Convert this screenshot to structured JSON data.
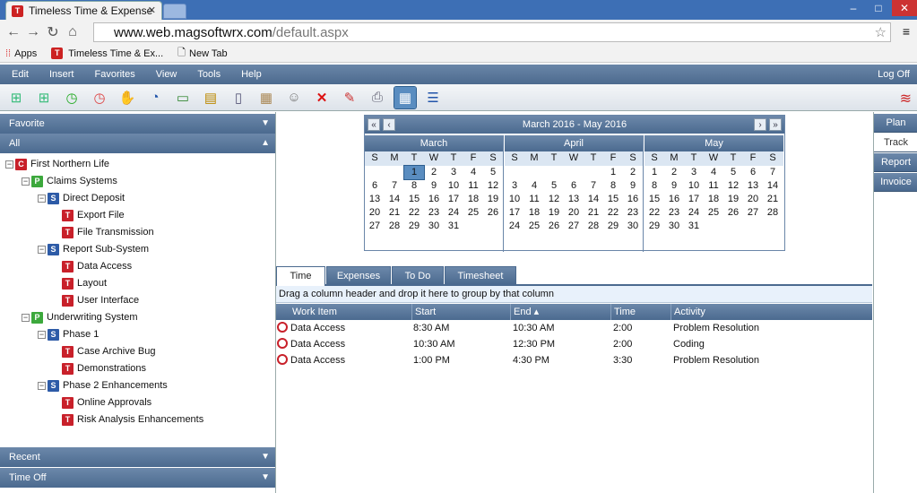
{
  "browser": {
    "tab_title": "Timeless Time & Expense",
    "url_domain": "www.web.magsoftwrx.com",
    "url_path": "/default.aspx"
  },
  "bookmarks": {
    "apps": "Apps",
    "site": "Timeless Time & Ex...",
    "newtab": "New Tab"
  },
  "menu": {
    "items": [
      "Edit",
      "Insert",
      "Favorites",
      "View",
      "Tools",
      "Help"
    ],
    "logoff": "Log Off"
  },
  "toolbar": {
    "icons": [
      "add-folder-icon",
      "add-item-icon",
      "start-timer-icon",
      "stop-timer-icon",
      "hand-icon",
      "stopwatch-icon",
      "money-icon",
      "clipboard-icon",
      "document-icon",
      "table-icon",
      "user-icon",
      "delete-icon",
      "edit-icon",
      "print-icon",
      "calendar-icon",
      "tree-icon"
    ]
  },
  "sidebar": {
    "favorite": "Favorite",
    "all": "All",
    "recent": "Recent",
    "timeoff": "Time Off"
  },
  "tree": [
    {
      "badge": "C",
      "label": "First Northern Life",
      "level": 0,
      "expander": "−"
    },
    {
      "badge": "P",
      "label": "Claims Systems",
      "level": 1,
      "expander": "−"
    },
    {
      "badge": "S",
      "label": "Direct Deposit",
      "level": 2,
      "expander": "−"
    },
    {
      "badge": "T",
      "label": "Export File",
      "level": 3,
      "expander": ""
    },
    {
      "badge": "T",
      "label": "File Transmission",
      "level": 3,
      "expander": ""
    },
    {
      "badge": "S",
      "label": "Report Sub-System",
      "level": 2,
      "expander": "−"
    },
    {
      "badge": "T",
      "label": "Data Access",
      "level": 3,
      "expander": ""
    },
    {
      "badge": "T",
      "label": "Layout",
      "level": 3,
      "expander": ""
    },
    {
      "badge": "T",
      "label": "User Interface",
      "level": 3,
      "expander": ""
    },
    {
      "badge": "P",
      "label": "Underwriting System",
      "level": 1,
      "expander": "−"
    },
    {
      "badge": "S",
      "label": "Phase 1",
      "level": 2,
      "expander": "−"
    },
    {
      "badge": "T",
      "label": "Case Archive Bug",
      "level": 3,
      "expander": ""
    },
    {
      "badge": "T",
      "label": "Demonstrations",
      "level": 3,
      "expander": ""
    },
    {
      "badge": "S",
      "label": "Phase 2 Enhancements",
      "level": 2,
      "expander": "−"
    },
    {
      "badge": "T",
      "label": "Online Approvals",
      "level": 3,
      "expander": ""
    },
    {
      "badge": "T",
      "label": "Risk Analysis Enhancements",
      "level": 3,
      "expander": ""
    }
  ],
  "calendar": {
    "range": "March 2016 - May 2016",
    "dow": [
      "S",
      "M",
      "T",
      "W",
      "T",
      "F",
      "S"
    ],
    "months": [
      {
        "name": "March",
        "weeks": [
          [
            "",
            "",
            "1",
            "2",
            "3",
            "4",
            "5"
          ],
          [
            "6",
            "7",
            "8",
            "9",
            "10",
            "11",
            "12"
          ],
          [
            "13",
            "14",
            "15",
            "16",
            "17",
            "18",
            "19"
          ],
          [
            "20",
            "21",
            "22",
            "23",
            "24",
            "25",
            "26"
          ],
          [
            "27",
            "28",
            "29",
            "30",
            "31",
            "",
            ""
          ]
        ],
        "selected": "1"
      },
      {
        "name": "April",
        "weeks": [
          [
            "",
            "",
            "",
            "",
            "",
            "1",
            "2"
          ],
          [
            "3",
            "4",
            "5",
            "6",
            "7",
            "8",
            "9"
          ],
          [
            "10",
            "11",
            "12",
            "13",
            "14",
            "15",
            "16"
          ],
          [
            "17",
            "18",
            "19",
            "20",
            "21",
            "22",
            "23"
          ],
          [
            "24",
            "25",
            "26",
            "27",
            "28",
            "29",
            "30"
          ]
        ],
        "selected": ""
      },
      {
        "name": "May",
        "weeks": [
          [
            "1",
            "2",
            "3",
            "4",
            "5",
            "6",
            "7"
          ],
          [
            "8",
            "9",
            "10",
            "11",
            "12",
            "13",
            "14"
          ],
          [
            "15",
            "16",
            "17",
            "18",
            "19",
            "20",
            "21"
          ],
          [
            "22",
            "23",
            "24",
            "25",
            "26",
            "27",
            "28"
          ],
          [
            "29",
            "30",
            "31",
            "",
            "",
            "",
            ""
          ]
        ],
        "selected": ""
      }
    ]
  },
  "tabs": [
    "Time",
    "Expenses",
    "To Do",
    "Timesheet"
  ],
  "grouping_hint": "Drag a column header and drop it here to group by that column",
  "grid": {
    "columns": [
      "Work Item",
      "Start",
      "End ▴",
      "Time",
      "Activity"
    ],
    "rows": [
      {
        "work_item": "Data Access",
        "start": "8:30 AM",
        "end": "10:30 AM",
        "time": "2:00",
        "activity": "Problem Resolution"
      },
      {
        "work_item": "Data Access",
        "start": "10:30 AM",
        "end": "12:30 PM",
        "time": "2:00",
        "activity": "Coding"
      },
      {
        "work_item": "Data Access",
        "start": "1:00 PM",
        "end": "4:30 PM",
        "time": "3:30",
        "activity": "Problem Resolution"
      }
    ]
  },
  "rightnav": [
    "Plan",
    "Track",
    "Report",
    "Invoice"
  ],
  "rightnav_active": "Track"
}
